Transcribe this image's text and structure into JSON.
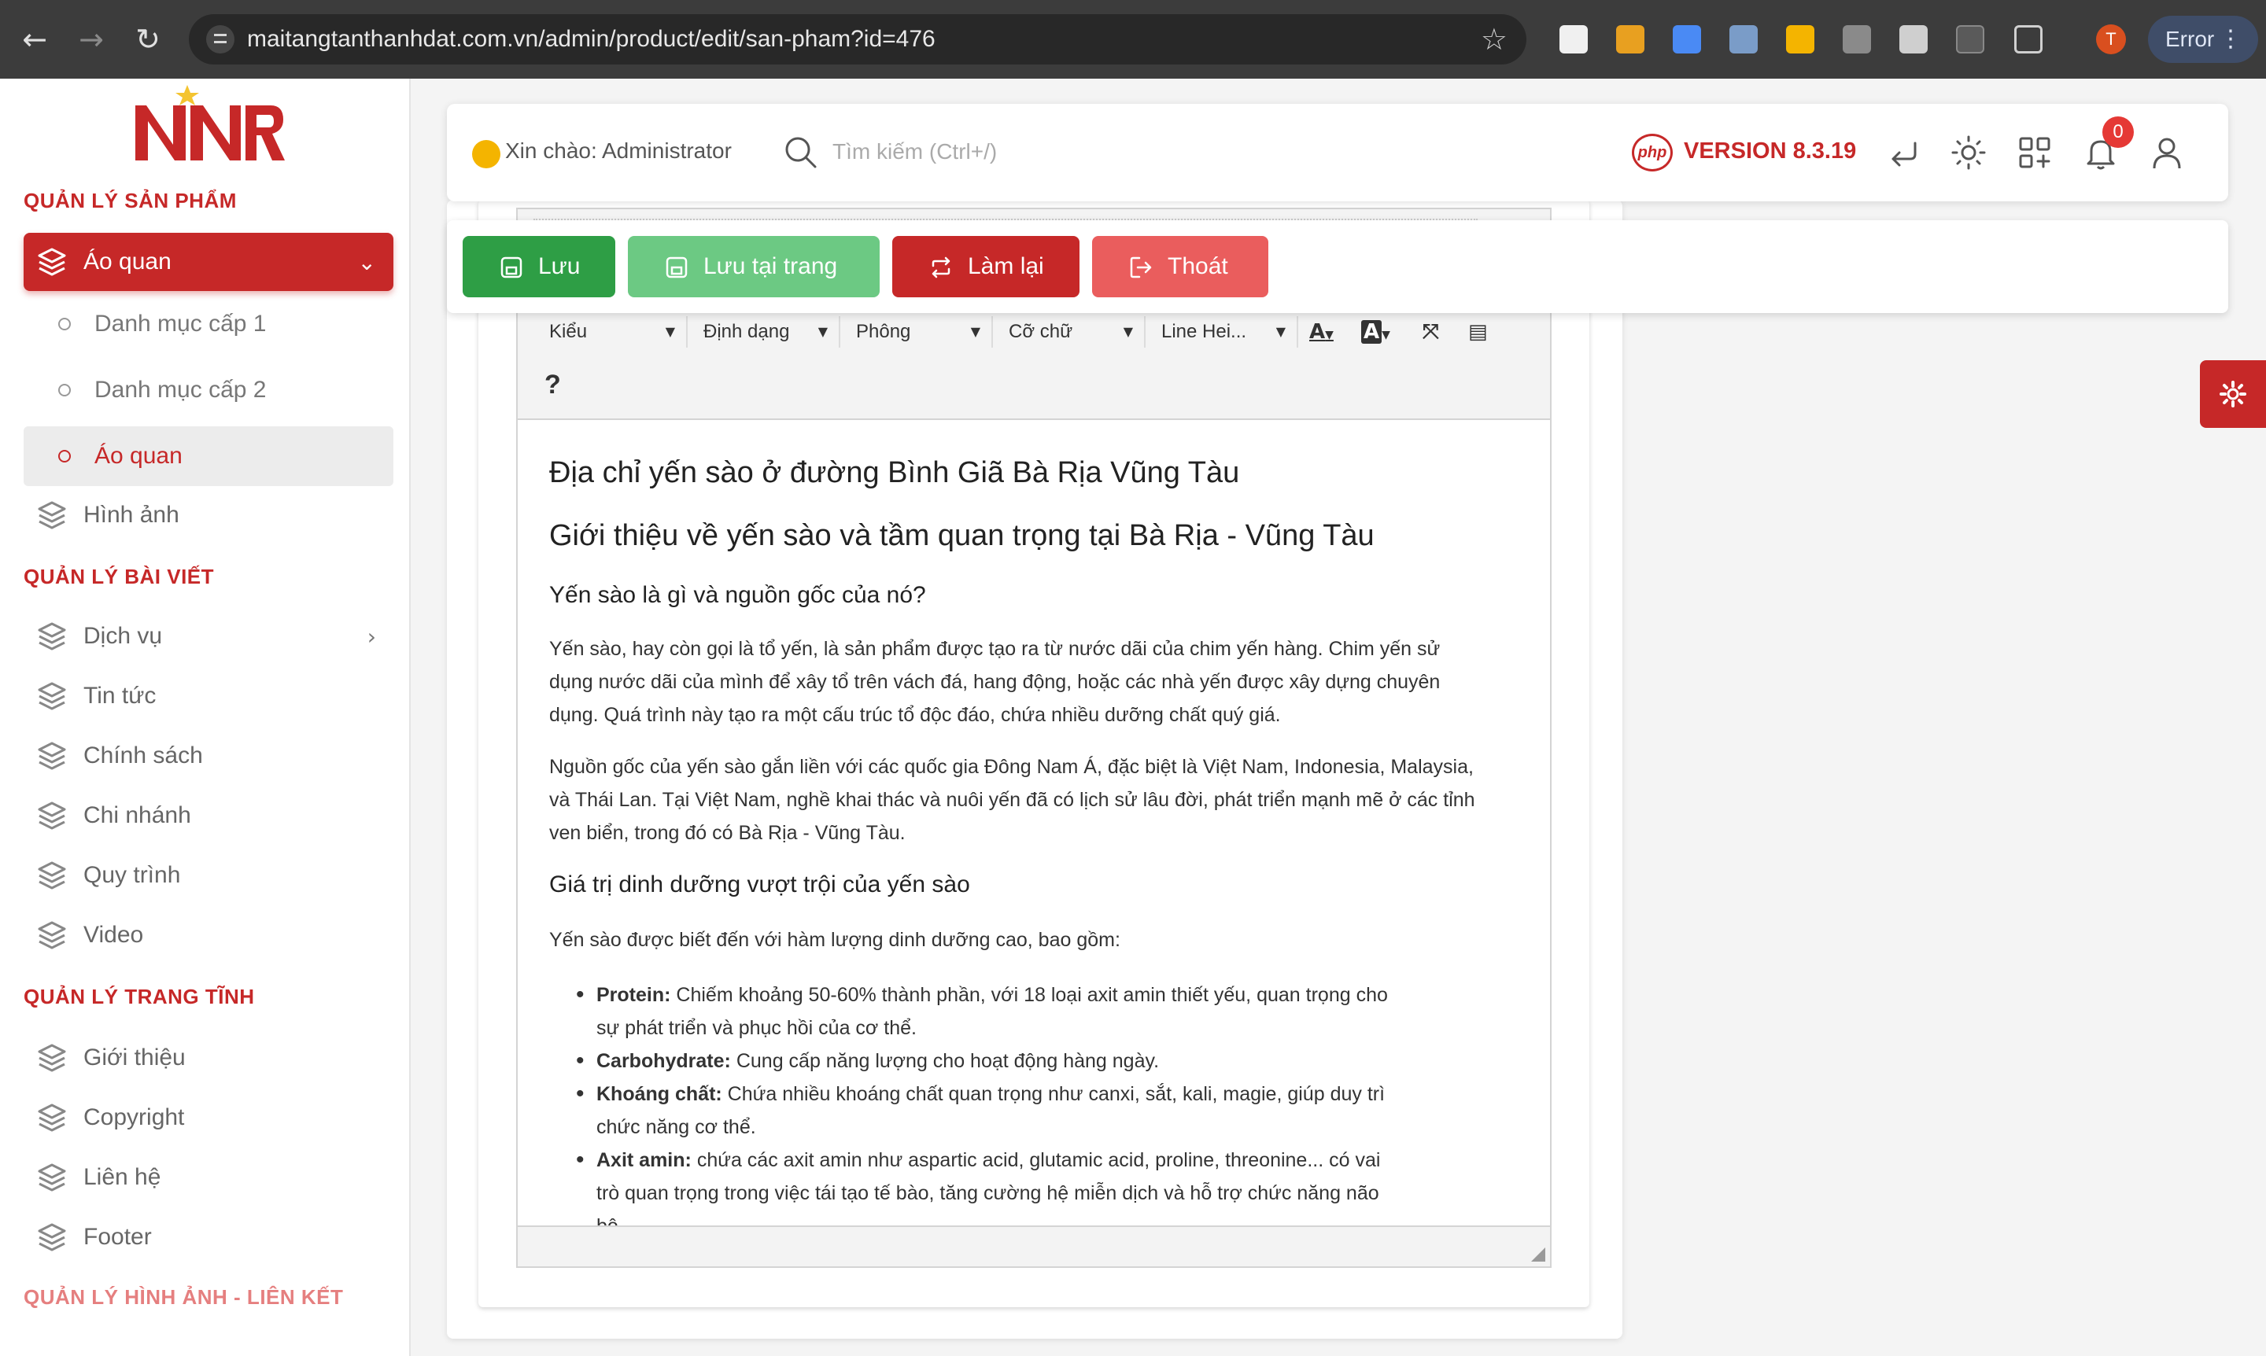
{
  "browser": {
    "url": "maitangtanthanhdat.com.vn/admin/product/edit/san-pham?id=476",
    "profile_initial": "T",
    "error_label": "Error",
    "menu_glyph": "⋮"
  },
  "sidebar": {
    "sections": [
      {
        "title": "QUẢN LÝ SẢN PHẨM"
      },
      {
        "title": "QUẢN LÝ BÀI VIẾT"
      },
      {
        "title": "QUẢN LÝ TRANG TĨNH"
      },
      {
        "title": "QUẢN LÝ HÌNH ẢNH - LIÊN KẾT"
      }
    ],
    "product_menu": {
      "label": "Áo quan",
      "sub_items": [
        "Danh mục cấp 1",
        "Danh mục cấp 2",
        "Áo quan"
      ]
    },
    "product_other": [
      "Hình ảnh"
    ],
    "post_items": [
      "Dịch vụ",
      "Tin tức",
      "Chính sách",
      "Chi nhánh",
      "Quy trình",
      "Video"
    ],
    "static_items": [
      "Giới thiệu",
      "Copyright",
      "Liên hệ",
      "Footer"
    ]
  },
  "header": {
    "greeting": "Xin chào: Administrator",
    "search_placeholder": "Tìm kiếm (Ctrl+/)",
    "php_label": "php",
    "version": "VERSION 8.3.19",
    "notification_count": "0"
  },
  "actions": {
    "save": "Lưu",
    "save_stay": "Lưu tại trang",
    "reset": "Làm lại",
    "exit": "Thoát"
  },
  "editor": {
    "combos": [
      "Kiểu",
      "Định dạng",
      "Phông",
      "Cỡ chữ",
      "Line Hei..."
    ],
    "text_color_glyph": "A",
    "bg_color_glyph": "A",
    "help": "?",
    "content": {
      "h1": "Địa chỉ yến sào ở đường Bình Giã Bà Rịa Vũng Tàu",
      "h2": "Giới thiệu về yến sào và tầm quan trọng tại Bà Rịa - Vũng Tàu",
      "h3a": "Yến sào là gì và nguồn gốc của nó?",
      "p1a": "Yến sào, hay còn gọi là tổ yến, là sản phẩm được tạo ra từ nước dãi của chim yến hàng. Chim yến sử",
      "p1b": "dụng nước dãi của mình để xây tổ trên vách đá, hang động, hoặc các nhà yến được xây dựng chuyên",
      "p1c": "dụng. Quá trình này tạo ra một cấu trúc tổ độc đáo, chứa nhiều dưỡng chất quý giá.",
      "p2a": "Nguồn gốc của yến sào gắn liền với các quốc gia Đông Nam Á, đặc biệt là Việt Nam, Indonesia, Malaysia,",
      "p2b": "và Thái Lan. Tại Việt Nam, nghề khai thác và nuôi yến đã có lịch sử lâu đời, phát triển mạnh mẽ ở các tỉnh",
      "p2c": "ven biển, trong đó có Bà Rịa - Vũng Tàu.",
      "h3b": "Giá trị dinh dưỡng vượt trội của yến sào",
      "p3": "Yến sào được biết đến với hàm lượng dinh dưỡng cao, bao gồm:",
      "list": [
        {
          "term": "Protein:",
          "text": "Chiếm khoảng 50-60% thành phần, với 18 loại axit amin thiết yếu, quan trọng cho",
          "cont": "sự phát triển và phục hồi của cơ thể."
        },
        {
          "term": "Carbohydrate:",
          "text": "Cung cấp năng lượng cho hoạt động hàng ngày.",
          "cont": ""
        },
        {
          "term": "Khoáng chất:",
          "text": "Chứa nhiều khoáng chất quan trọng như canxi, sắt, kali, magie, giúp duy trì",
          "cont": "chức năng cơ thể."
        },
        {
          "term": "Axit amin:",
          "text": "chứa các axit amin như aspartic acid, glutamic acid, proline, threonine... có vai",
          "cont": "trò quan trọng trong việc tái tạo tế bào, tăng cường hệ miễn dịch và hỗ trợ chức năng não",
          "cont2": "bộ."
        }
      ]
    }
  },
  "icons": {
    "back": "back-arrow-icon",
    "forward": "forward-arrow-icon",
    "reload": "reload-icon",
    "site_settings": "site-settings-icon",
    "bookmark": "star-icon",
    "search": "search-icon",
    "undo": "return-icon",
    "theme": "sun-icon",
    "apps": "apps-grid-icon",
    "bell": "bell-icon",
    "user": "user-icon",
    "layers": "layers-icon",
    "settings": "gear-icon"
  },
  "colors": {
    "brand": "#c62828",
    "save": "#2e9e45",
    "save_stay": "#6cc983",
    "exit": "#ea5d5d"
  }
}
